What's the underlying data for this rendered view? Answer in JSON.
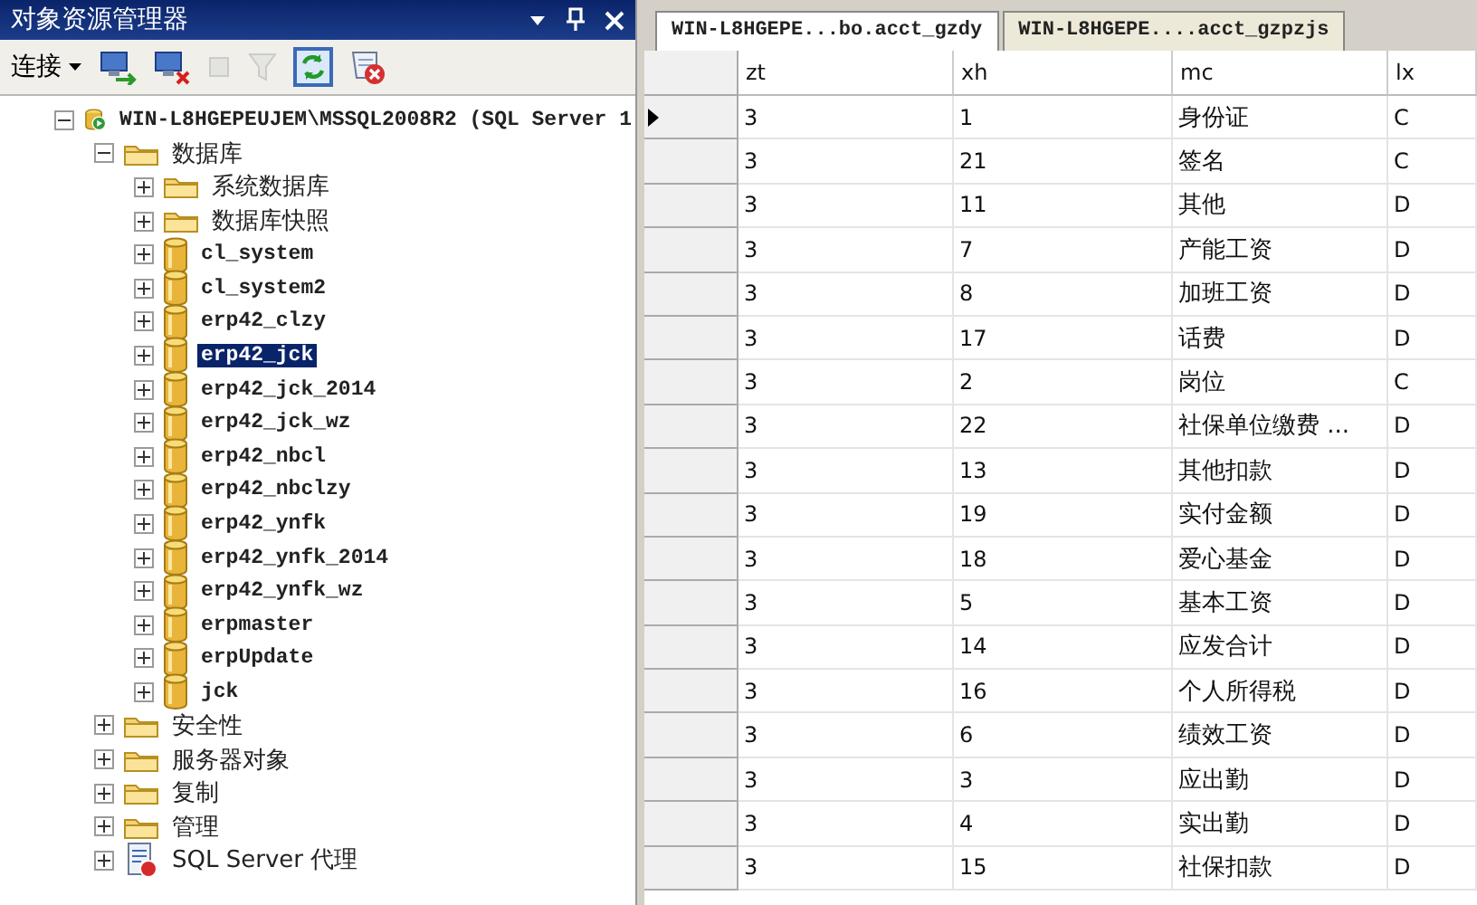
{
  "explorer": {
    "title": "对象资源管理器",
    "title_buttons": [
      {
        "kind": "dropdown"
      },
      {
        "kind": "pin"
      },
      {
        "kind": "close"
      }
    ],
    "toolbar": {
      "connect_label": "连接",
      "buttons": [
        {
          "kind": "connect",
          "disabled": false
        },
        {
          "kind": "disconnect",
          "disabled": false
        },
        {
          "kind": "stop",
          "disabled": true
        },
        {
          "kind": "filter",
          "disabled": true
        },
        {
          "kind": "refresh",
          "disabled": false
        },
        {
          "kind": "report",
          "disabled": false
        }
      ]
    },
    "tree": [
      {
        "kind": "server",
        "label": "WIN-L8HGEPEUJEM\\MSSQL2008R2 (SQL Server 1",
        "expanded": true,
        "selected": false,
        "children": [
          {
            "kind": "folder",
            "label": "数据库",
            "expanded": true,
            "selected": false,
            "children": [
              {
                "kind": "folder",
                "label": "系统数据库",
                "expanded": false,
                "selected": false
              },
              {
                "kind": "folder",
                "label": "数据库快照",
                "expanded": false,
                "selected": false
              },
              {
                "kind": "database",
                "label": "cl_system",
                "expanded": false,
                "selected": false
              },
              {
                "kind": "database",
                "label": "cl_system2",
                "expanded": false,
                "selected": false
              },
              {
                "kind": "database",
                "label": "erp42_clzy",
                "expanded": false,
                "selected": false
              },
              {
                "kind": "database",
                "label": "erp42_jck",
                "expanded": false,
                "selected": true
              },
              {
                "kind": "database",
                "label": "erp42_jck_2014",
                "expanded": false,
                "selected": false
              },
              {
                "kind": "database",
                "label": "erp42_jck_wz",
                "expanded": false,
                "selected": false
              },
              {
                "kind": "database",
                "label": "erp42_nbcl",
                "expanded": false,
                "selected": false
              },
              {
                "kind": "database",
                "label": "erp42_nbclzy",
                "expanded": false,
                "selected": false
              },
              {
                "kind": "database",
                "label": "erp42_ynfk",
                "expanded": false,
                "selected": false
              },
              {
                "kind": "database",
                "label": "erp42_ynfk_2014",
                "expanded": false,
                "selected": false
              },
              {
                "kind": "database",
                "label": "erp42_ynfk_wz",
                "expanded": false,
                "selected": false
              },
              {
                "kind": "database",
                "label": "erpmaster",
                "expanded": false,
                "selected": false
              },
              {
                "kind": "database",
                "label": "erpUpdate",
                "expanded": false,
                "selected": false
              },
              {
                "kind": "database",
                "label": "jck",
                "expanded": false,
                "selected": false
              }
            ]
          },
          {
            "kind": "folder",
            "label": "安全性",
            "expanded": false,
            "selected": false
          },
          {
            "kind": "folder",
            "label": "服务器对象",
            "expanded": false,
            "selected": false
          },
          {
            "kind": "folder",
            "label": "复制",
            "expanded": false,
            "selected": false
          },
          {
            "kind": "folder",
            "label": "管理",
            "expanded": false,
            "selected": false
          },
          {
            "kind": "agent",
            "label": "SQL Server 代理",
            "expanded": false,
            "selected": false
          }
        ]
      }
    ]
  },
  "document": {
    "tabs": [
      {
        "label": "WIN-L8HGEPE...bo.acct_gzdy",
        "selected": true
      },
      {
        "label": "WIN-L8HGEPE....acct_gzpzjs",
        "selected": false
      }
    ],
    "table": {
      "columns": [
        "zt",
        "xh",
        "mc",
        "lx"
      ],
      "rows": [
        {
          "current": true,
          "cells": [
            "3",
            "1",
            "身份证",
            "C"
          ]
        },
        {
          "current": false,
          "cells": [
            "3",
            "21",
            "签名",
            "C"
          ]
        },
        {
          "current": false,
          "cells": [
            "3",
            "11",
            "其他",
            "D"
          ]
        },
        {
          "current": false,
          "cells": [
            "3",
            "7",
            "产能工资",
            "D"
          ]
        },
        {
          "current": false,
          "cells": [
            "3",
            "8",
            "加班工资",
            "D"
          ]
        },
        {
          "current": false,
          "cells": [
            "3",
            "17",
            "话费",
            "D"
          ]
        },
        {
          "current": false,
          "cells": [
            "3",
            "2",
            "岗位",
            "C"
          ]
        },
        {
          "current": false,
          "cells": [
            "3",
            "22",
            "社保单位缴费 ...",
            "D"
          ]
        },
        {
          "current": false,
          "cells": [
            "3",
            "13",
            "其他扣款",
            "D"
          ]
        },
        {
          "current": false,
          "cells": [
            "3",
            "19",
            "实付金额",
            "D"
          ]
        },
        {
          "current": false,
          "cells": [
            "3",
            "18",
            "爱心基金",
            "D"
          ]
        },
        {
          "current": false,
          "cells": [
            "3",
            "5",
            "基本工资",
            "D"
          ]
        },
        {
          "current": false,
          "cells": [
            "3",
            "14",
            "应发合计",
            "D"
          ]
        },
        {
          "current": false,
          "cells": [
            "3",
            "16",
            "个人所得税",
            "D"
          ]
        },
        {
          "current": false,
          "cells": [
            "3",
            "6",
            "绩效工资",
            "D"
          ]
        },
        {
          "current": false,
          "cells": [
            "3",
            "3",
            "应出勤",
            "D"
          ]
        },
        {
          "current": false,
          "cells": [
            "3",
            "4",
            "实出勤",
            "D"
          ]
        },
        {
          "current": false,
          "cells": [
            "3",
            "15",
            "社保扣款",
            "D"
          ]
        }
      ]
    }
  }
}
